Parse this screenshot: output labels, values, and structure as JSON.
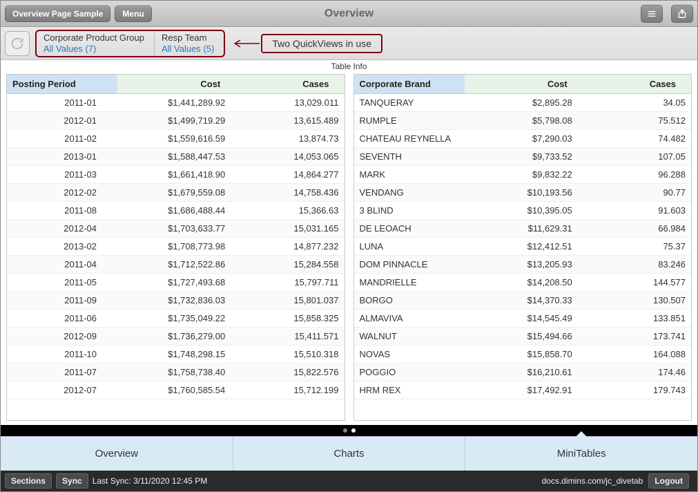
{
  "topbar": {
    "title": "Overview",
    "back_label": "Overview Page Sample",
    "menu_label": "Menu"
  },
  "quickviews": [
    {
      "label": "Corporate Product Group",
      "value": "All Values (7)"
    },
    {
      "label": "Resp Team",
      "value": "All Values (5)"
    }
  ],
  "annotation": "Two QuickViews in use",
  "table_info_label": "Table Info",
  "tables": {
    "left": {
      "dim_header": "Posting Period",
      "cols": [
        "Cost",
        "Cases"
      ],
      "rows": [
        {
          "d": "2011-01",
          "v": [
            "$1,441,289.92",
            "13,029.011"
          ]
        },
        {
          "d": "2012-01",
          "v": [
            "$1,499,719.29",
            "13,615.489"
          ]
        },
        {
          "d": "2011-02",
          "v": [
            "$1,559,616.59",
            "13,874.73"
          ]
        },
        {
          "d": "2013-01",
          "v": [
            "$1,588,447.53",
            "14,053.065"
          ]
        },
        {
          "d": "2011-03",
          "v": [
            "$1,661,418.90",
            "14,864.277"
          ]
        },
        {
          "d": "2012-02",
          "v": [
            "$1,679,559.08",
            "14,758.436"
          ]
        },
        {
          "d": "2011-08",
          "v": [
            "$1,686,488.44",
            "15,366.63"
          ]
        },
        {
          "d": "2012-04",
          "v": [
            "$1,703,633.77",
            "15,031.165"
          ]
        },
        {
          "d": "2013-02",
          "v": [
            "$1,708,773.98",
            "14,877.232"
          ]
        },
        {
          "d": "2011-04",
          "v": [
            "$1,712,522.86",
            "15,284.558"
          ]
        },
        {
          "d": "2011-05",
          "v": [
            "$1,727,493.68",
            "15,797.711"
          ]
        },
        {
          "d": "2011-09",
          "v": [
            "$1,732,836.03",
            "15,801.037"
          ]
        },
        {
          "d": "2011-06",
          "v": [
            "$1,735,049.22",
            "15,858.325"
          ]
        },
        {
          "d": "2012-09",
          "v": [
            "$1,736,279.00",
            "15,411.571"
          ]
        },
        {
          "d": "2011-10",
          "v": [
            "$1,748,298.15",
            "15,510.318"
          ]
        },
        {
          "d": "2011-07",
          "v": [
            "$1,758,738.40",
            "15,822.576"
          ]
        },
        {
          "d": "2012-07",
          "v": [
            "$1,760,585.54",
            "15,712.199"
          ]
        }
      ]
    },
    "right": {
      "dim_header": "Corporate Brand",
      "cols": [
        "Cost",
        "Cases"
      ],
      "rows": [
        {
          "d": "TANQUERAY",
          "v": [
            "$2,895.28",
            "34.05"
          ]
        },
        {
          "d": "RUMPLE",
          "v": [
            "$5,798.08",
            "75.512"
          ]
        },
        {
          "d": "CHATEAU REYNELLA",
          "v": [
            "$7,290.03",
            "74.482"
          ]
        },
        {
          "d": "SEVENTH",
          "v": [
            "$9,733.52",
            "107.05"
          ]
        },
        {
          "d": "MARK",
          "v": [
            "$9,832.22",
            "96.288"
          ]
        },
        {
          "d": "VENDANG",
          "v": [
            "$10,193.56",
            "90.77"
          ]
        },
        {
          "d": "3 BLIND",
          "v": [
            "$10,395.05",
            "91.603"
          ]
        },
        {
          "d": "DE LEOACH",
          "v": [
            "$11,629.31",
            "66.984"
          ]
        },
        {
          "d": "LUNA",
          "v": [
            "$12,412.51",
            "75.37"
          ]
        },
        {
          "d": "DOM PINNACLE",
          "v": [
            "$13,205.93",
            "83.246"
          ]
        },
        {
          "d": "MANDRIELLE",
          "v": [
            "$14,208.50",
            "144.577"
          ]
        },
        {
          "d": "BORGO",
          "v": [
            "$14,370.33",
            "130.507"
          ]
        },
        {
          "d": "ALMAVIVA",
          "v": [
            "$14,545.49",
            "133.851"
          ]
        },
        {
          "d": "WALNUT",
          "v": [
            "$15,494.66",
            "173.741"
          ]
        },
        {
          "d": "NOVAS",
          "v": [
            "$15,858.70",
            "164.088"
          ]
        },
        {
          "d": "POGGIO",
          "v": [
            "$16,210.61",
            "174.46"
          ]
        },
        {
          "d": "HRM REX",
          "v": [
            "$17,492.91",
            "179.743"
          ]
        }
      ]
    }
  },
  "tabs": [
    {
      "label": "Overview",
      "active": false
    },
    {
      "label": "Charts",
      "active": false
    },
    {
      "label": "MiniTables",
      "active": true
    }
  ],
  "status": {
    "sections_label": "Sections",
    "sync_label": "Sync",
    "last_sync": "Last Sync: 3/11/2020 12:45 PM",
    "host": "docs.dimins.com/jc_divetab",
    "logout_label": "Logout"
  }
}
